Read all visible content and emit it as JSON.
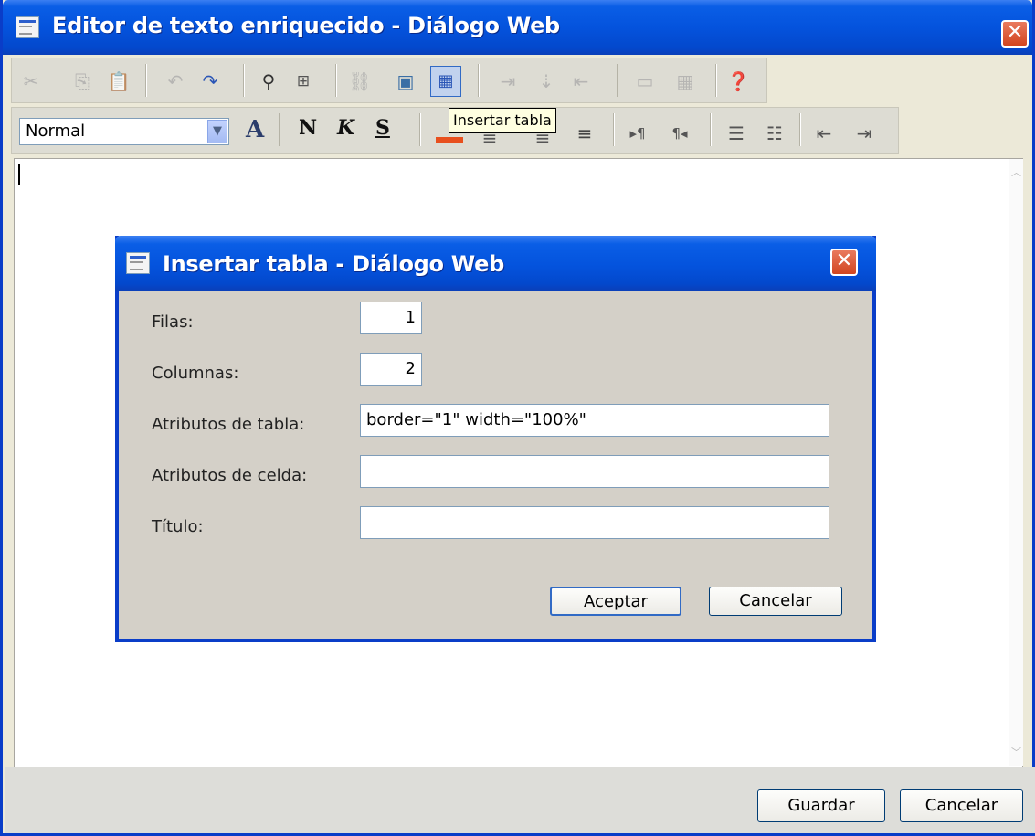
{
  "window": {
    "title": "Editor de texto enriquecido - Diálogo Web",
    "close_glyph": "✕"
  },
  "toolbar1": {
    "icons": [
      "cut-icon",
      "copy-icon",
      "paste-icon",
      "undo-icon",
      "redo-icon",
      "find-icon",
      "select-all-icon",
      "link-icon",
      "image-icon",
      "table-icon",
      "insert-row-icon",
      "insert-column-icon",
      "merge-cells-icon",
      "cell-props-icon",
      "table-props-icon",
      "help-icon"
    ]
  },
  "toolbar2": {
    "style_select": {
      "value": "Normal",
      "arrow": "▼"
    },
    "font_color": "A",
    "bold": "N",
    "italic": "K",
    "underline": "S"
  },
  "tooltip": "Insertar tabla",
  "dialog": {
    "title": "Insertar tabla - Diálogo Web",
    "close_glyph": "✕",
    "fields": {
      "rows": {
        "label": "Filas:",
        "value": "1"
      },
      "columns": {
        "label": "Columnas:",
        "value": "2"
      },
      "table_attrs": {
        "label": "Atributos de tabla:",
        "value": "border=\"1\" width=\"100%\""
      },
      "cell_attrs": {
        "label": "Atributos de celda:",
        "value": ""
      },
      "caption": {
        "label": "Título:",
        "value": ""
      }
    },
    "ok_label": "Aceptar",
    "cancel_label": "Cancelar"
  },
  "footer": {
    "save_label": "Guardar",
    "cancel_label": "Cancelar"
  },
  "colors": {
    "titlebar": "#0453dd",
    "close": "#d2451f",
    "dialog_bg": "#d4d0c8",
    "font_color_bar": "#e8501e"
  }
}
